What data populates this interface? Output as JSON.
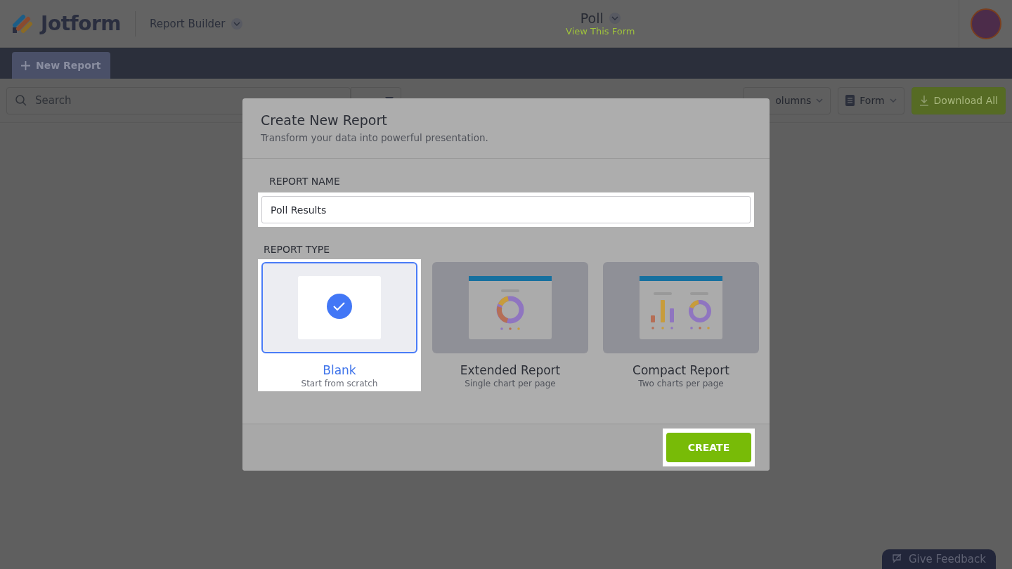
{
  "header": {
    "logo": "Jotform",
    "app_switcher": "Report Builder",
    "form_title": "Poll",
    "form_link": "View This Form"
  },
  "nav": {
    "new_report": "New Report"
  },
  "toolbar": {
    "search": {
      "placeholder": "Search"
    },
    "buttons": [
      {
        "label": "olumns",
        "kind": "plain"
      },
      {
        "label": "Form",
        "kind": "form"
      },
      {
        "label": "Download All",
        "kind": "download"
      }
    ]
  },
  "modal": {
    "title": "Create New Report",
    "subtitle": "Transform your data into powerful presentation.",
    "name_label": "REPORT NAME",
    "name_value": "Poll Results",
    "type_label": "REPORT TYPE",
    "types": [
      {
        "kind": "blank",
        "title": "Blank",
        "subtitle": "Start from scratch",
        "selected": true
      },
      {
        "kind": "extended",
        "title": "Extended Report",
        "subtitle": "Single chart per page",
        "selected": false
      },
      {
        "kind": "compact",
        "title": "Compact Report",
        "subtitle": "Two charts per page",
        "selected": false
      }
    ],
    "create": "CREATE"
  },
  "feedback": "Give Feedback"
}
